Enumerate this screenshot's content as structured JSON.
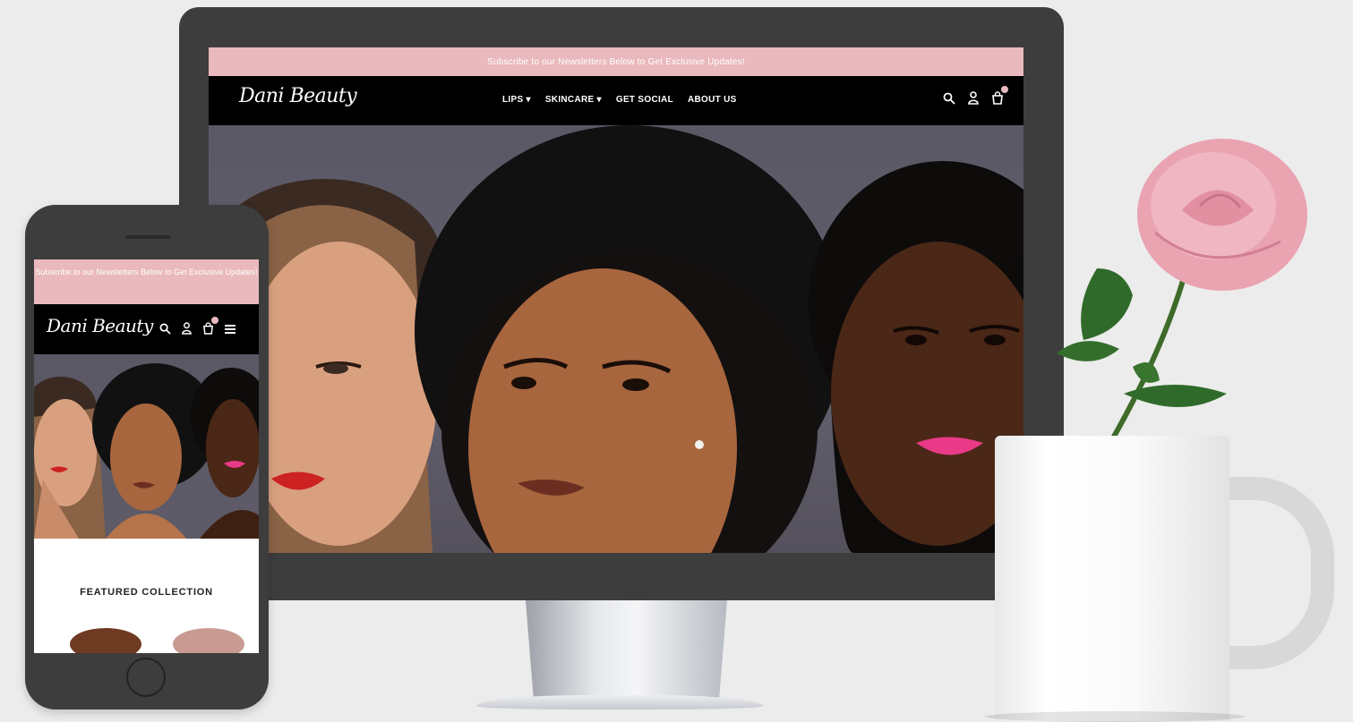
{
  "desktop": {
    "announcement": "Subscribe to our Newsletters Below to Get Exclusive Updates!",
    "logo": "Dani Beauty",
    "nav": [
      "LIPS ▾",
      "SKINCARE ▾",
      "GET SOCIAL",
      "ABOUT US"
    ],
    "icons": [
      "search-icon",
      "account-icon",
      "cart-icon"
    ]
  },
  "mobile": {
    "announcement": "Subscribe to our Newsletters Below to Get Exclusive Updates!",
    "logo": "Dani Beauty",
    "icons": [
      "search-icon",
      "account-icon",
      "cart-icon",
      "menu-icon"
    ],
    "featured_title": "FEATURED COLLECTION"
  },
  "colors": {
    "announcement_bg": "#e9b9bd",
    "header_bg": "#000000",
    "device_frame": "#3d3d3d"
  }
}
